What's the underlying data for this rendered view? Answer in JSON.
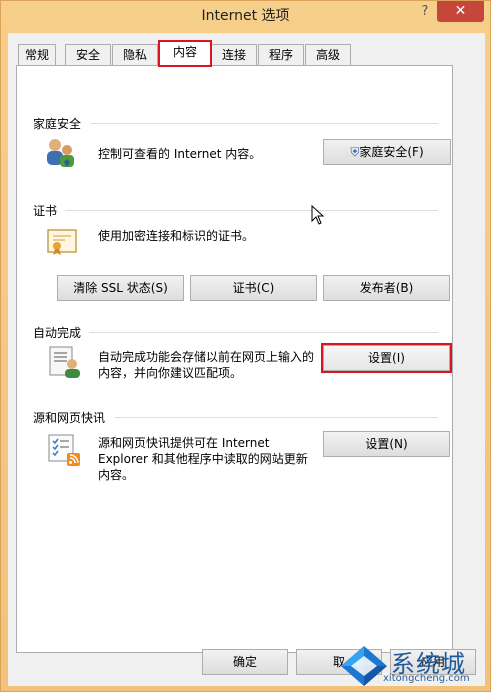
{
  "window": {
    "title": "Internet 选项",
    "close_label": "✕",
    "help_label": "?"
  },
  "tabs": [
    "常规",
    "安全",
    "隐私",
    "内容",
    "连接",
    "程序",
    "高级"
  ],
  "groups": {
    "family": {
      "title": "家庭安全",
      "desc": "控制可查看的 Internet 内容。",
      "button": "家庭安全(F)"
    },
    "cert": {
      "title": "证书",
      "desc": "使用加密连接和标识的证书。",
      "buttons": [
        "清除 SSL 状态(S)",
        "证书(C)",
        "发布者(B)"
      ]
    },
    "autocomplete": {
      "title": "自动完成",
      "desc_line1": "自动完成功能会存储以前在网页上输入的",
      "desc_line2": "内容，并向你建议匹配项。",
      "button": "设置(I)"
    },
    "feeds": {
      "title": "源和网页快讯",
      "desc_line1": "源和网页快讯提供可在 Internet",
      "desc_line2": "Explorer 和其他程序中读取的网站更新",
      "desc_line3": "内容。",
      "button": "设置(N)"
    }
  },
  "footer": {
    "ok": "确定",
    "cancel": "取",
    "apply": "应用"
  },
  "watermark": {
    "text": "系统城",
    "url": "xitongcheng.com"
  },
  "colors": {
    "highlight": "#d9161f",
    "titlebar": "#f2c27a",
    "close": "#c7463a"
  }
}
